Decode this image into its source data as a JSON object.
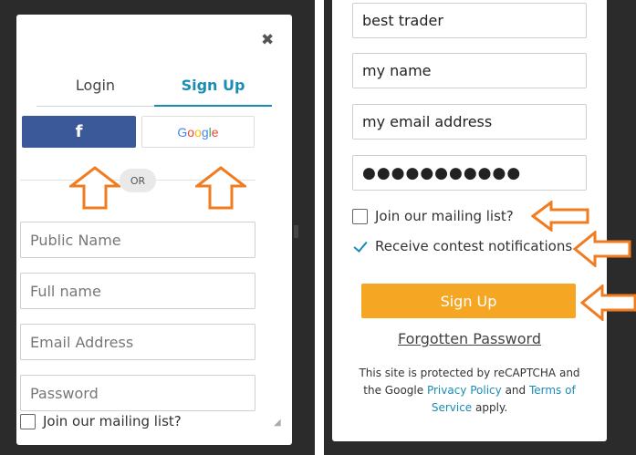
{
  "left": {
    "close_icon": "close-icon",
    "tabs": [
      {
        "label": "Login"
      },
      {
        "label": "Sign Up"
      }
    ],
    "facebook_label": "f",
    "google_label": "Google",
    "or_label": "OR",
    "fields": [
      {
        "placeholder": "Public Name"
      },
      {
        "placeholder": "Full name"
      },
      {
        "placeholder": "Email Address"
      },
      {
        "placeholder": "Password"
      }
    ],
    "mailing_label": "Join our mailing list?"
  },
  "right": {
    "fields": [
      {
        "value": "best trader"
      },
      {
        "value": "my name"
      },
      {
        "value": "my email address"
      },
      {
        "value": "●●●●●●●●●●●"
      }
    ],
    "mailing_label": "Join our mailing list?",
    "notifications_label": "Receive contest notifications",
    "signup_label": "Sign Up",
    "forgot_label": "Forgotten Password",
    "recaptcha": {
      "text1": "This site is protected by reCAPTCHA and the Google",
      "privacy": "Privacy Policy",
      "and": "and",
      "terms": "Terms of Service",
      "apply": "apply."
    }
  },
  "colors": {
    "accent": "#1a8cb6",
    "facebook": "#3b5998",
    "signup": "#f5a623",
    "annotation": "#f07c22"
  }
}
